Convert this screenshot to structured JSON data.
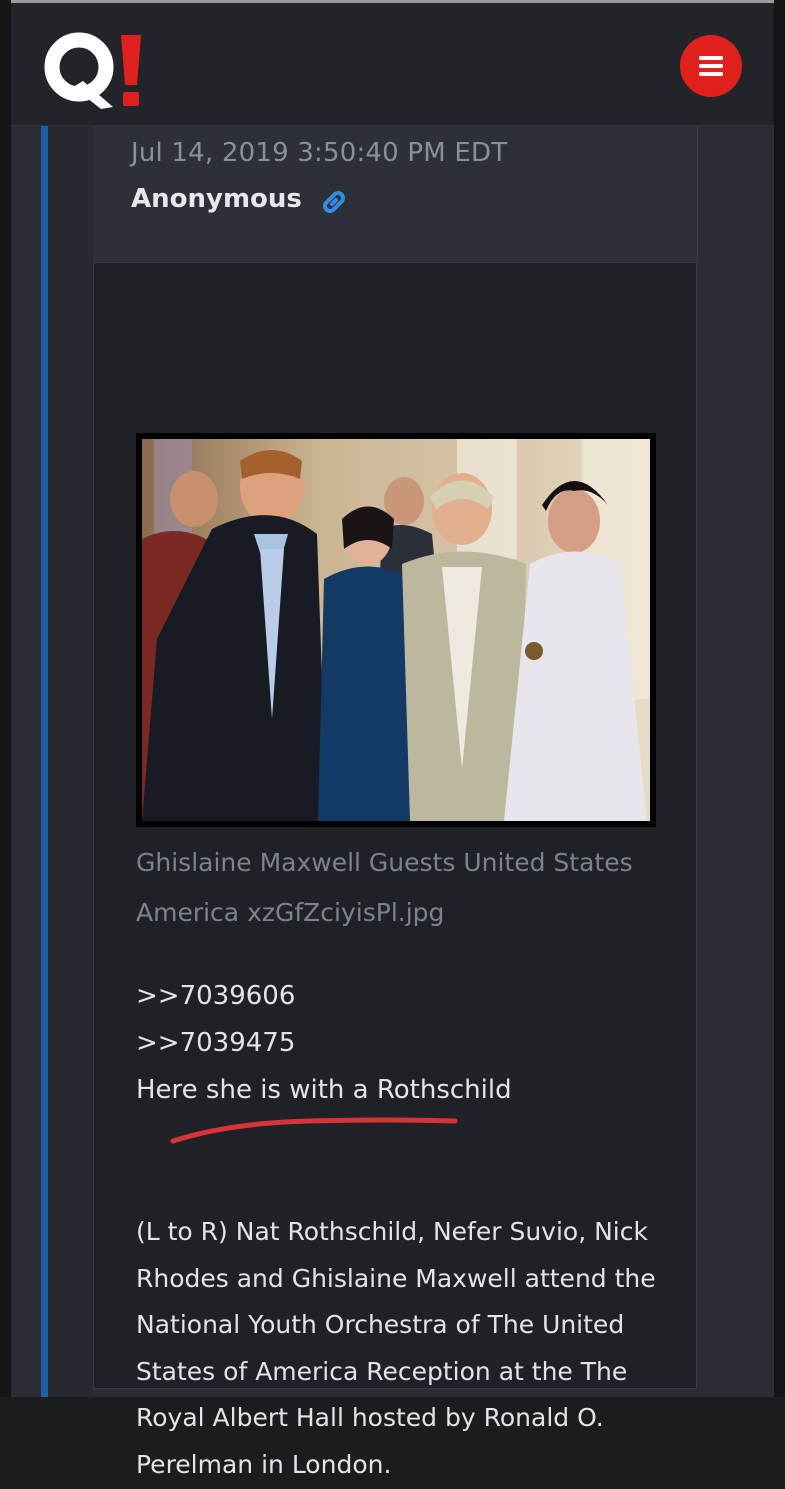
{
  "app": {
    "logo_text": "Q!",
    "menu_icon": "hamburger-icon"
  },
  "post": {
    "timestamp": "Jul 14, 2019 3:50:40 PM EDT",
    "author": "Anonymous",
    "link_icon": "link-icon",
    "image": {
      "filename": "Ghislaine Maxwell Guests United States America xzGfZciyisPl.jpg"
    },
    "quotes": [
      ">>7039606",
      ">>7039475"
    ],
    "text_line": "Here she is with a Rothschild",
    "caption": "(L to R) Nat Rothschild, Nefer Suvio, Nick Rhodes and Ghislaine Maxwell attend the National Youth Orchestra of The United States of America Reception at the The Royal Albert Hall hosted by Ronald O. Perelman in London."
  },
  "colors": {
    "accent_red": "#e0201d",
    "thread_bar_blue": "#1f5fa8",
    "link_blue": "#2f8de4",
    "annotation_red": "#d8333a"
  }
}
